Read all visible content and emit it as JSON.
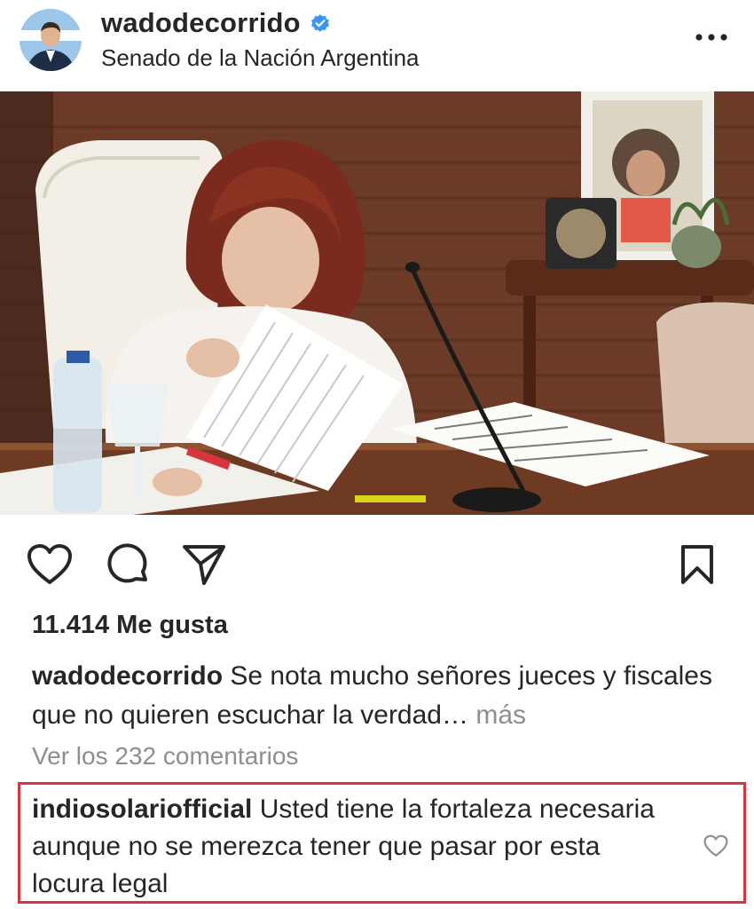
{
  "header": {
    "username": "wadodecorrido",
    "location": "Senado de la Nación Argentina",
    "verified": true,
    "verified_color": "#3897f0",
    "more_icon": "more-horizontal-icon"
  },
  "photo": {
    "description_icon": "post-photo"
  },
  "actions": {
    "like_icon": "heart-icon",
    "comment_icon": "comment-icon",
    "share_icon": "send-icon",
    "save_icon": "bookmark-icon"
  },
  "likes": {
    "text": "11.414 Me gusta"
  },
  "caption": {
    "username": "wadodecorrido",
    "text": "Se nota mucho señores jueces y fiscales que no quieren escuchar la verdad…",
    "more": "más"
  },
  "comments": {
    "view_all": "Ver los 232 comentarios",
    "highlight_color": "#d8343d",
    "items": [
      {
        "username": "indiosolariofficial",
        "text": "Usted tiene la fortaleza necesaria aunque no se merezca tener que pasar por esta locura legal"
      }
    ]
  }
}
